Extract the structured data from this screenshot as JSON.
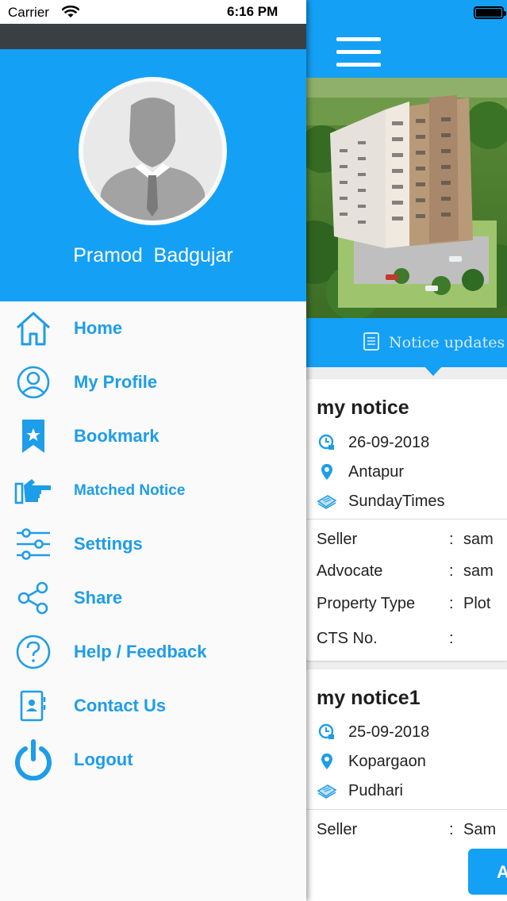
{
  "status_bar": {
    "carrier": "Carrier",
    "time": "6:16 PM"
  },
  "profile": {
    "name": "Pramod  Badgujar"
  },
  "menu": [
    {
      "label": "Home",
      "icon": "home-icon"
    },
    {
      "label": "My Profile",
      "icon": "user-circle-icon"
    },
    {
      "label": "Bookmark",
      "icon": "bookmark-icon"
    },
    {
      "label": "Matched Notice",
      "icon": "pointing-hand-icon"
    },
    {
      "label": "Settings",
      "icon": "sliders-icon"
    },
    {
      "label": "Share",
      "icon": "share-icon"
    },
    {
      "label": "Help / Feedback",
      "icon": "help-icon"
    },
    {
      "label": "Contact Us",
      "icon": "contact-book-icon"
    },
    {
      "label": "Logout",
      "icon": "power-icon"
    }
  ],
  "main": {
    "tab_label": "Notice updates",
    "notices": [
      {
        "title": "my notice",
        "date": "26-09-2018",
        "location": "Antapur",
        "newspaper": "SundayTimes",
        "fields": [
          {
            "key": "Seller",
            "colon": ":",
            "value": "sam"
          },
          {
            "key": "Advocate",
            "colon": ":",
            "value": "sam"
          },
          {
            "key": "Property Type",
            "colon": ":",
            "value": "Plot"
          },
          {
            "key": "CTS No.",
            "colon": ":",
            "value": ""
          }
        ]
      },
      {
        "title": "my notice1",
        "date": "25-09-2018",
        "location": "Kopargaon",
        "newspaper": "Pudhari",
        "fields": [
          {
            "key": "Seller",
            "colon": ":",
            "value": "Sam"
          }
        ]
      }
    ],
    "fab_label": "A"
  },
  "colors": {
    "primary": "#14a0f5",
    "menu_text": "#1e9de8",
    "dark_strip": "#3a3f44"
  }
}
